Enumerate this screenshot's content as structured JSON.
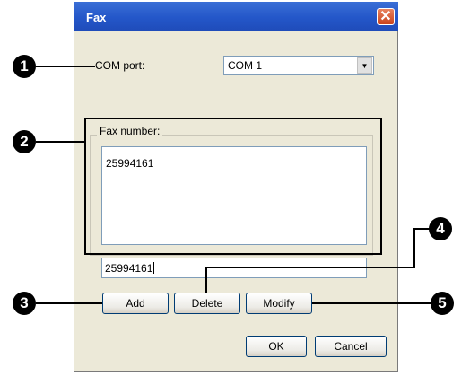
{
  "dialog": {
    "title": "Fax",
    "close_symbol": "✕"
  },
  "com_port": {
    "label": "COM port:",
    "value": "COM 1",
    "arrow": "▼"
  },
  "fax_group": {
    "label": "Fax number:",
    "list_items": [
      "25994161"
    ]
  },
  "fax_input": {
    "value": "25994161"
  },
  "buttons": {
    "add": "Add",
    "delete": "Delete",
    "modify": "Modify",
    "ok": "OK",
    "cancel": "Cancel"
  },
  "callouts": [
    "1",
    "2",
    "3",
    "4",
    "5"
  ],
  "colors": {
    "titlebar": "#2457c9",
    "dialog_bg": "#ece9d8",
    "close_button": "#c8431d"
  }
}
